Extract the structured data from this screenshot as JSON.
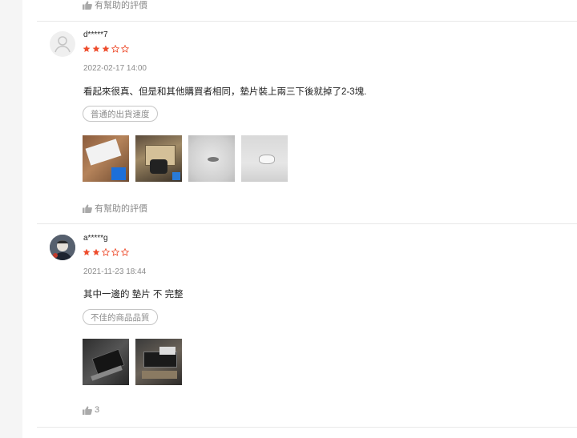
{
  "top": {
    "helpful_label": "有幫助的評價"
  },
  "reviews": [
    {
      "username": "d*****7",
      "rating": 3,
      "max_rating": 5,
      "date": "2022-02-17 14:00",
      "comment": "看起來很真、但是和其他購買者相同，墊片裝上兩三下後就掉了2-3塊.",
      "tag": "普通的出貨速度",
      "photo_count": 4,
      "helpful_label": "有幫助的評價"
    },
    {
      "username": "a*****g",
      "rating": 2,
      "max_rating": 5,
      "date": "2021-11-23 18:44",
      "comment": "其中一邊的 墊片 不 完整",
      "tag": "不佳的商品品質",
      "photo_count": 2,
      "helpful_count": "3"
    }
  ],
  "colors": {
    "star": "#ee4d2d",
    "muted": "#8c8c8c",
    "divider": "#e8e8e8"
  },
  "icons": [
    "thumbs-up-icon",
    "user-icon",
    "star-icon"
  ]
}
